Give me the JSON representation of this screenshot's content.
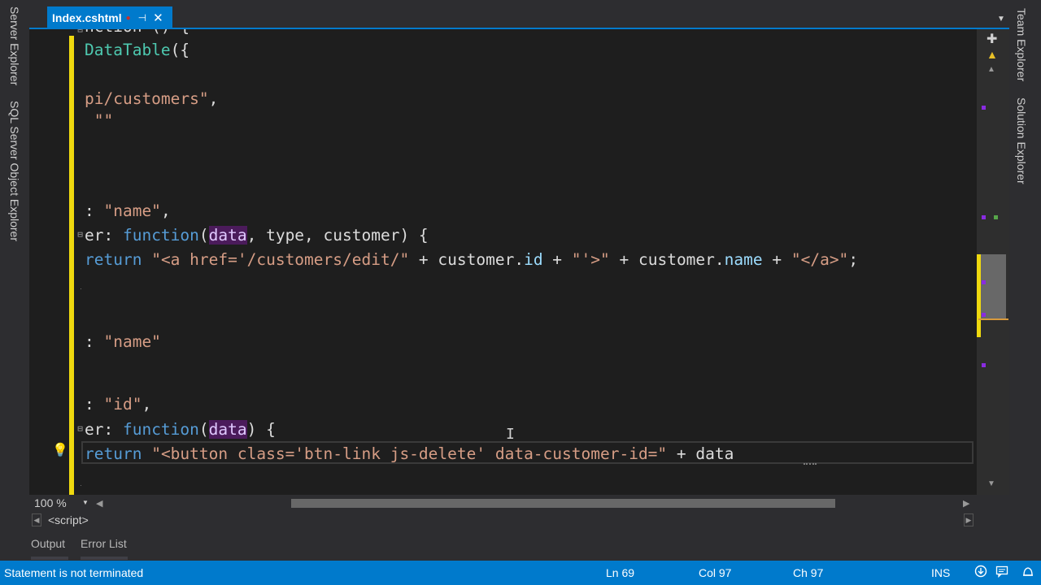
{
  "left_toolbar": {
    "tabs": [
      "Server Explorer",
      "SQL Server Object Explorer"
    ]
  },
  "right_toolbar": {
    "tabs": [
      "Team Explorer",
      "Solution Explorer"
    ]
  },
  "document_tab": {
    "title": "Index.cshtml",
    "modified_dot": "●",
    "pin_glyph": "⊣",
    "close_glyph": "✕",
    "dropdown_glyph": "▼"
  },
  "editor": {
    "lines": [
      {
        "segments": [
          {
            "t": "nction () {",
            "c": "plain"
          }
        ]
      },
      {
        "segments": [
          {
            "t": "DataTable",
            "c": "type"
          },
          {
            "t": "({",
            "c": "plain"
          }
        ]
      },
      {
        "segments": [
          {
            "t": "pi/customers\"",
            "c": "str"
          },
          {
            "t": ",",
            "c": "plain"
          }
        ]
      },
      {
        "segments": [
          {
            "t": " \"\"",
            "c": "str"
          }
        ]
      },
      {
        "segments": [
          {
            "t": ": ",
            "c": "plain"
          },
          {
            "t": "\"name\"",
            "c": "str"
          },
          {
            "t": ",",
            "c": "plain"
          }
        ]
      },
      {
        "segments": [
          {
            "t": "er",
            "c": "plain"
          },
          {
            "t": ": ",
            "c": "plain"
          },
          {
            "t": "function",
            "c": "kw"
          },
          {
            "t": "(",
            "c": "plain"
          },
          {
            "t": "data",
            "c": "hl"
          },
          {
            "t": ", type, customer) {",
            "c": "plain"
          }
        ]
      },
      {
        "segments": [
          {
            "t": "return",
            "c": "kw"
          },
          {
            "t": " ",
            "c": "plain"
          },
          {
            "t": "\"<a href='/customers/edit/\"",
            "c": "str"
          },
          {
            "t": " + customer.",
            "c": "plain"
          },
          {
            "t": "id",
            "c": "prop"
          },
          {
            "t": " + ",
            "c": "plain"
          },
          {
            "t": "\"'>\"",
            "c": "str"
          },
          {
            "t": " + customer.",
            "c": "plain"
          },
          {
            "t": "name",
            "c": "prop"
          },
          {
            "t": " + ",
            "c": "plain"
          },
          {
            "t": "\"</a>\"",
            "c": "str"
          },
          {
            "t": ";",
            "c": "plain"
          }
        ]
      },
      {
        "segments": [
          {
            "t": ": ",
            "c": "plain"
          },
          {
            "t": "\"name\"",
            "c": "str"
          }
        ]
      },
      {
        "segments": [
          {
            "t": ": ",
            "c": "plain"
          },
          {
            "t": "\"id\"",
            "c": "str"
          },
          {
            "t": ",",
            "c": "plain"
          }
        ]
      },
      {
        "segments": [
          {
            "t": "er",
            "c": "plain"
          },
          {
            "t": ": ",
            "c": "plain"
          },
          {
            "t": "function",
            "c": "kw"
          },
          {
            "t": "(",
            "c": "plain"
          },
          {
            "t": "data",
            "c": "hl"
          },
          {
            "t": ") {",
            "c": "plain"
          }
        ]
      },
      {
        "segments": [
          {
            "t": "return",
            "c": "kw"
          },
          {
            "t": " ",
            "c": "plain"
          },
          {
            "t": "\"<button class='btn-link js-delete' data-customer-id=\"",
            "c": "str"
          },
          {
            "t": " + data",
            "c": "plain"
          }
        ]
      }
    ],
    "fold_glyph": "⊟",
    "lightbulb_glyph": "💡",
    "ibeam_glyph": "I"
  },
  "vertical_scrollbar": {
    "split_glyph": "✚",
    "warning_glyph": "▲",
    "up_glyph": "▲",
    "down_glyph": "▼",
    "marker_colors": {
      "purple": "#8a2be2",
      "green": "#57a64a",
      "yellow": "#efd90f"
    }
  },
  "bottom": {
    "zoom": "100 %",
    "zoom_arrow": "▼",
    "scroll_left_glyph": "◀",
    "scroll_right_glyph": "▶",
    "nav_left_glyph": "◀",
    "nav_right_glyph": "▶",
    "nav_scope": "<script>",
    "panel_tabs": [
      "Output",
      "Error List"
    ]
  },
  "status_bar": {
    "message": "Statement is not terminated",
    "line": "Ln 69",
    "col": "Col 97",
    "ch": "Ch 97",
    "mode": "INS",
    "icons": [
      "publish-icon",
      "feedback-icon",
      "notification-icon"
    ]
  },
  "colors": {
    "accent": "#007acc",
    "editor_bg": "#1e1e1e",
    "change_bar": "#efd90f"
  }
}
